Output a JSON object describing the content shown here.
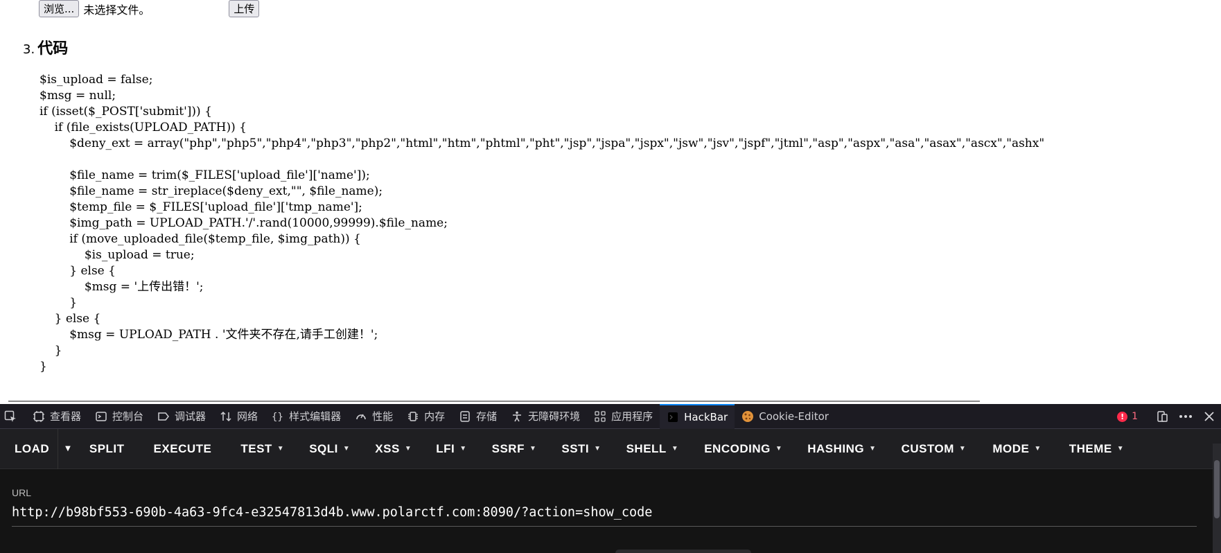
{
  "upload": {
    "browse_label": "浏览...",
    "file_status": "未选择文件。",
    "upload_label": "上传"
  },
  "section": {
    "number": "3.",
    "title": "代码"
  },
  "code_lines": [
    "$is_upload = false;",
    "$msg = null;",
    "if (isset($_POST['submit'])) {",
    "    if (file_exists(UPLOAD_PATH)) {",
    "        $deny_ext = array(\"php\",\"php5\",\"php4\",\"php3\",\"php2\",\"html\",\"htm\",\"phtml\",\"pht\",\"jsp\",\"jspa\",\"jspx\",\"jsw\",\"jsv\",\"jspf\",\"jtml\",\"asp\",\"aspx\",\"asa\",\"asax\",\"ascx\",\"ashx\"",
    "",
    "        $file_name = trim($_FILES['upload_file']['name']);",
    "        $file_name = str_ireplace($deny_ext,\"\", $file_name);",
    "        $temp_file = $_FILES['upload_file']['tmp_name'];",
    "        $img_path = UPLOAD_PATH.'/'.rand(10000,99999).$file_name;",
    "        if (move_uploaded_file($temp_file, $img_path)) {",
    "            $is_upload = true;",
    "        } else {",
    "            $msg = '上传出错！';",
    "        }",
    "    } else {",
    "        $msg = UPLOAD_PATH . '文件夹不存在,请手工创建！';",
    "    }",
    "}"
  ],
  "devtools": {
    "tabs": [
      {
        "label": "查看器",
        "icon": "inspector-icon"
      },
      {
        "label": "控制台",
        "icon": "console-icon"
      },
      {
        "label": "调试器",
        "icon": "debugger-icon"
      },
      {
        "label": "网络",
        "icon": "network-icon"
      },
      {
        "label": "样式编辑器",
        "icon": "style-editor-icon"
      },
      {
        "label": "性能",
        "icon": "performance-icon"
      },
      {
        "label": "内存",
        "icon": "memory-icon"
      },
      {
        "label": "存储",
        "icon": "storage-icon"
      },
      {
        "label": "无障碍环境",
        "icon": "accessibility-icon"
      },
      {
        "label": "应用程序",
        "icon": "application-icon"
      },
      {
        "label": "HackBar",
        "icon": "hackbar-icon"
      },
      {
        "label": "Cookie-Editor",
        "icon": "cookie-icon"
      }
    ],
    "active_tab": "HackBar",
    "error_count": "1",
    "accent_color": "#0a84ff"
  },
  "hackbar": {
    "buttons": [
      "LOAD",
      "SPLIT",
      "EXECUTE",
      "TEST",
      "SQLI",
      "XSS",
      "LFI",
      "SSRF",
      "SSTI",
      "SHELL",
      "ENCODING",
      "HASHING",
      "CUSTOM",
      "MODE",
      "THEME"
    ],
    "url_label": "URL",
    "url_value": "http://b98bf553-690b-4a63-9fc4-e32547813d4b.www.polarctf.com:8090/?action=show_code"
  }
}
